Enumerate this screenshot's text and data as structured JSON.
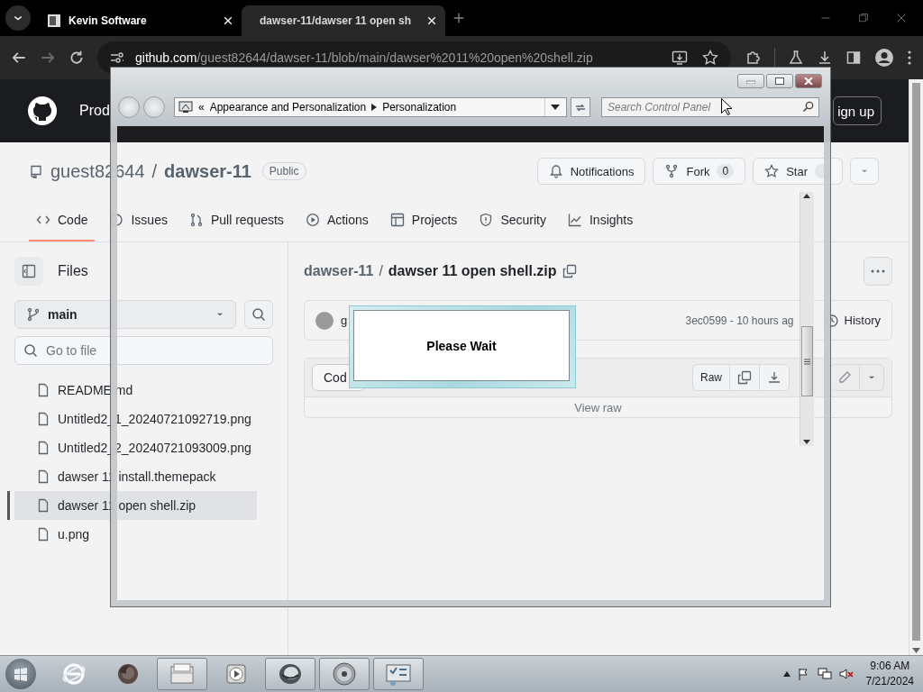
{
  "browser": {
    "tabs": [
      {
        "title": "Kevin Software",
        "selected": false
      },
      {
        "title": "dawser-11/dawser 11 open sh",
        "selected": true
      }
    ],
    "url": {
      "host": "github.com",
      "path": "/guest82644/dawser-11/blob/main/dawser%2011%20open%20shell.zip"
    }
  },
  "github": {
    "header": {
      "nav_item": "Prod",
      "sign_up": "ign up"
    },
    "repo": {
      "owner": "guest82644",
      "separator": "/",
      "name": "dawser-11",
      "visibility": "Public"
    },
    "repo_actions": [
      {
        "kind": "notifications",
        "label": "Notifications"
      },
      {
        "kind": "fork",
        "label": "Fork",
        "count": "0"
      },
      {
        "kind": "star",
        "label": "Star"
      }
    ],
    "tabs": [
      {
        "label": "Code",
        "selected": true
      },
      {
        "label": "Issues",
        "selected": false
      },
      {
        "label": "Pull requests",
        "selected": false
      },
      {
        "label": "Actions",
        "selected": false
      },
      {
        "label": "Projects",
        "selected": false
      },
      {
        "label": "Security",
        "selected": false
      },
      {
        "label": "Insights",
        "selected": false
      }
    ],
    "sidebar": {
      "title": "Files",
      "branch": "main",
      "search_placeholder": "Go to file",
      "files": [
        {
          "name": "README.md",
          "selected": false
        },
        {
          "name": "Untitled2_1_20240721092719.png",
          "selected": false
        },
        {
          "name": "Untitled2_2_20240721093009.png",
          "selected": false
        },
        {
          "name": "dawser 11 install.themepack",
          "selected": false
        },
        {
          "name": "dawser 11 open shell.zip",
          "selected": true
        },
        {
          "name": "u.png",
          "selected": false
        }
      ]
    },
    "file_view": {
      "breadcrumb_repo": "dawser-11",
      "breadcrumb_separator": "/",
      "breadcrumb_file": "dawser 11 open shell.zip",
      "commit": {
        "author": "g",
        "summary": "3ec0599 - 10 hours ag",
        "history": "History"
      },
      "toolbar": {
        "code_tab": "Cod",
        "raw": "Raw"
      },
      "view_raw": "View raw"
    }
  },
  "control_panel": {
    "address": {
      "chevron": "«",
      "path": [
        "Appearance and Personalization",
        "Personalization"
      ]
    },
    "search_placeholder": "Search Control Panel"
  },
  "dialog": {
    "message": "Please Wait"
  },
  "taskbar": {
    "apps": [
      {
        "kind": "ie",
        "running": false
      },
      {
        "kind": "firefox",
        "running": false
      },
      {
        "kind": "explorer",
        "running": true
      },
      {
        "kind": "media",
        "running": false
      },
      {
        "kind": "app",
        "running": true
      },
      {
        "kind": "disc",
        "running": true
      },
      {
        "kind": "control-panel",
        "running": true
      }
    ],
    "clock": {
      "time": "9:06 AM",
      "date": "7/21/2024"
    }
  }
}
